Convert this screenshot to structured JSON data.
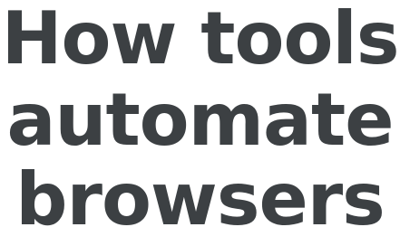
{
  "headline": {
    "lines": [
      "How tools",
      "automate",
      "browsers"
    ]
  },
  "colors": {
    "text": "#3c4043",
    "background": "#ffffff"
  }
}
